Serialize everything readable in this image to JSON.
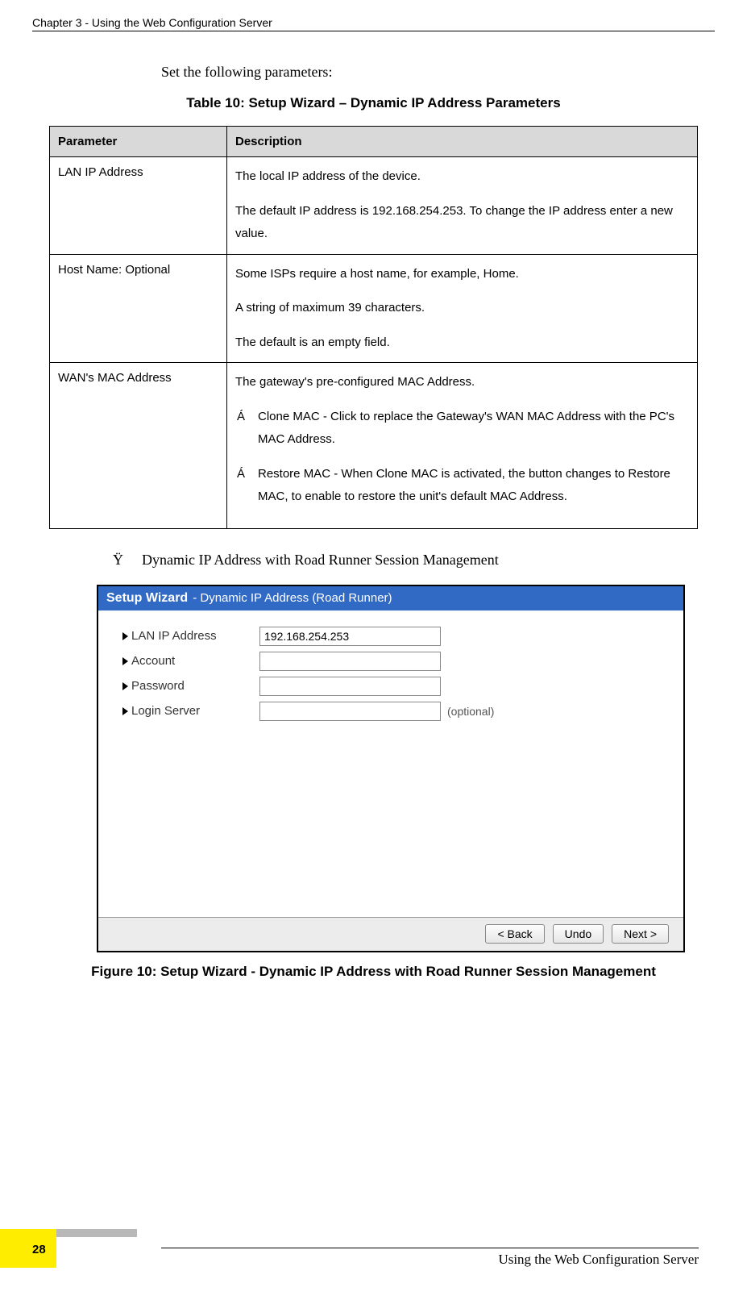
{
  "header": {
    "chapter": "Chapter 3 - Using the Web Configuration Server"
  },
  "intro": "Set the following parameters:",
  "table": {
    "caption": "Table 10: Setup Wizard – Dynamic IP Address Parameters",
    "col1": "Parameter",
    "col2": "Description",
    "rows": [
      {
        "param": "LAN IP Address",
        "p1": "The local IP address of the device.",
        "p2": "The default IP address is 192.168.254.253. To change the IP address enter a new value."
      },
      {
        "param": "Host Name: Optional",
        "p1": "Some ISPs require a host name, for example, Home.",
        "p2": "A string of maximum 39 characters.",
        "p3": "The default is an empty field."
      },
      {
        "param": "WAN's MAC Address",
        "p1": "The gateway's pre-configured MAC Address.",
        "li1": "Clone MAC - Click to replace the Gateway's WAN MAC Address with the PC's MAC Address.",
        "li2": "Restore MAC - When Clone MAC is activated, the button changes to Restore MAC, to enable to restore the unit's default MAC Address."
      }
    ]
  },
  "bullets": {
    "b1_mark": "Ÿ",
    "b1_text": "Dynamic IP Address with Road Runner Session Management"
  },
  "wizard": {
    "title_bold": "Setup Wizard",
    "title_sub": "- Dynamic IP Address (Road Runner)",
    "labels": {
      "lan": "LAN IP Address",
      "acc": "Account",
      "pwd": "Password",
      "srv": "Login Server"
    },
    "vals": {
      "lan": "192.168.254.253"
    },
    "optional": "(optional)",
    "btn_back": "< Back",
    "btn_undo": "Undo",
    "btn_next": "Next >"
  },
  "figure": {
    "caption": "Figure 10: Setup Wizard - Dynamic IP Address with Road Runner Session Management"
  },
  "footer": {
    "text": "Using the Web Configuration Server",
    "page": "28"
  },
  "glyphs": {
    "mac_bullet": "Á"
  }
}
